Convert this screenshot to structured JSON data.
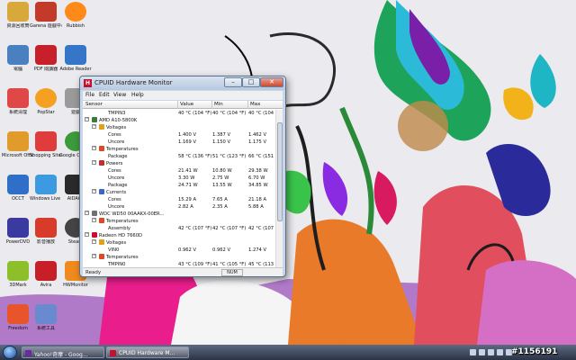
{
  "window": {
    "app_icon_letter": "H",
    "title": "CPUID Hardware Monitor",
    "buttons": {
      "minimize": "–",
      "maximize": "□",
      "close": "✕"
    },
    "menu": [
      "File",
      "Edit",
      "View",
      "Help"
    ],
    "columns": [
      "Sensor",
      "Value",
      "Min",
      "Max"
    ],
    "rows": [
      {
        "level": 3,
        "toggle": "",
        "icon": "",
        "label": "TMPIN3",
        "value": "40 °C (104 °F)",
        "min": "40 °C (104 °F)",
        "max": "40 °C (104 °F)"
      },
      {
        "level": 1,
        "toggle": "−",
        "icon": "cpu",
        "label": "AMD A10-5800K",
        "value": "",
        "min": "",
        "max": ""
      },
      {
        "level": 2,
        "toggle": "−",
        "icon": "voltage",
        "label": "Voltages",
        "value": "",
        "min": "",
        "max": ""
      },
      {
        "level": 3,
        "toggle": "",
        "icon": "",
        "label": "Cores",
        "value": "1.400 V",
        "min": "1.387 V",
        "max": "1.462 V"
      },
      {
        "level": 3,
        "toggle": "",
        "icon": "",
        "label": "Uncore",
        "value": "1.169 V",
        "min": "1.150 V",
        "max": "1.175 V"
      },
      {
        "level": 2,
        "toggle": "−",
        "icon": "temperature",
        "label": "Temperatures",
        "value": "",
        "min": "",
        "max": ""
      },
      {
        "level": 3,
        "toggle": "",
        "icon": "",
        "label": "Package",
        "value": "58 °C (136 °F)",
        "min": "51 °C (123 °F)",
        "max": "66 °C (151 °F)"
      },
      {
        "level": 2,
        "toggle": "−",
        "icon": "power",
        "label": "Powers",
        "value": "",
        "min": "",
        "max": ""
      },
      {
        "level": 3,
        "toggle": "",
        "icon": "",
        "label": "Cores",
        "value": "21.41 W",
        "min": "10.80 W",
        "max": "29.38 W"
      },
      {
        "level": 3,
        "toggle": "",
        "icon": "",
        "label": "Uncore",
        "value": "3.30 W",
        "min": "2.75 W",
        "max": "6.70 W"
      },
      {
        "level": 3,
        "toggle": "",
        "icon": "",
        "label": "Package",
        "value": "24.71 W",
        "min": "13.55 W",
        "max": "34.85 W"
      },
      {
        "level": 2,
        "toggle": "−",
        "icon": "current",
        "label": "Currents",
        "value": "",
        "min": "",
        "max": ""
      },
      {
        "level": 3,
        "toggle": "",
        "icon": "",
        "label": "Cores",
        "value": "15.29 A",
        "min": "7.65 A",
        "max": "21.18 A"
      },
      {
        "level": 3,
        "toggle": "",
        "icon": "",
        "label": "Uncore",
        "value": "2.82 A",
        "min": "2.35 A",
        "max": "5.88 A"
      },
      {
        "level": 1,
        "toggle": "−",
        "icon": "drive",
        "label": "WDC WD50 00AAKX-00ER...",
        "value": "",
        "min": "",
        "max": ""
      },
      {
        "level": 2,
        "toggle": "−",
        "icon": "temperature",
        "label": "Temperatures",
        "value": "",
        "min": "",
        "max": ""
      },
      {
        "level": 3,
        "toggle": "",
        "icon": "",
        "label": "Assembly",
        "value": "42 °C (107 °F)",
        "min": "42 °C (107 °F)",
        "max": "42 °C (107 °F)"
      },
      {
        "level": 1,
        "toggle": "−",
        "icon": "gpu",
        "label": "Radeon HD 7660D",
        "value": "",
        "min": "",
        "max": ""
      },
      {
        "level": 2,
        "toggle": "−",
        "icon": "voltage",
        "label": "Voltages",
        "value": "",
        "min": "",
        "max": ""
      },
      {
        "level": 3,
        "toggle": "",
        "icon": "",
        "label": "VIN0",
        "value": "0.962 V",
        "min": "0.962 V",
        "max": "1.274 V"
      },
      {
        "level": 2,
        "toggle": "−",
        "icon": "temperature",
        "label": "Temperatures",
        "value": "",
        "min": "",
        "max": ""
      },
      {
        "level": 3,
        "toggle": "",
        "icon": "",
        "label": "TMPIN0",
        "value": "43 °C (109 °F)",
        "min": "41 °C (105 °F)",
        "max": "45 °C (113 °F)"
      }
    ],
    "status": "Ready",
    "num_indicator": "NUM"
  },
  "desktop_icons": [
    {
      "label": "資源回收筒",
      "color": "#d8a93a"
    },
    {
      "label": "Garena 遊戲中心",
      "color": "#c43a2a"
    },
    {
      "label": "Rubbish",
      "color": "#ff8a1a"
    },
    {
      "label": "電腦",
      "color": "#4a7fc0"
    },
    {
      "label": "PDF 閱讀器",
      "color": "#c8202a"
    },
    {
      "label": "Adobe Reader",
      "color": "#3576c8"
    },
    {
      "label": "系統清理",
      "color": "#e04848"
    },
    {
      "label": "PopStar",
      "color": "#f4a020"
    },
    {
      "label": "遊戲",
      "color": "#9a9a9a"
    },
    {
      "label": "Microsoft Office",
      "color": "#e09b2a"
    },
    {
      "label": "Shopping Sites",
      "color": "#e03c3c"
    },
    {
      "label": "Google Chrome",
      "color": "#3c9a3c"
    },
    {
      "label": "OCCT",
      "color": "#2f6fc8"
    },
    {
      "label": "Windows Live Mess...",
      "color": "#3b9ae0"
    },
    {
      "label": "AIDA64",
      "color": "#2a2a2a"
    },
    {
      "label": "PowerDVD",
      "color": "#3a3aa0"
    },
    {
      "label": "影音播放",
      "color": "#d93b2b"
    },
    {
      "label": "Steam",
      "color": "#444444"
    },
    {
      "label": "3DMark",
      "color": "#8cbf2a"
    },
    {
      "label": "Avira",
      "color": "#c81e28"
    },
    {
      "label": "HWMonitor",
      "color": "#f08a1e"
    },
    {
      "label": "Freedom",
      "color": "#e8552a"
    },
    {
      "label": "系統工具",
      "color": "#6a8ad0"
    }
  ],
  "taskbar": {
    "tasks": [
      {
        "label": "Yahoo!奇摩 - Goog...",
        "color": "#6a2aa0"
      },
      {
        "label": "CPUID Hardware M...",
        "color": "#c8102e"
      }
    ],
    "tray_icons": [
      "network-icon",
      "volume-icon",
      "security-icon",
      "language-icon",
      "clock-icon"
    ]
  },
  "watermark": "#1156191"
}
